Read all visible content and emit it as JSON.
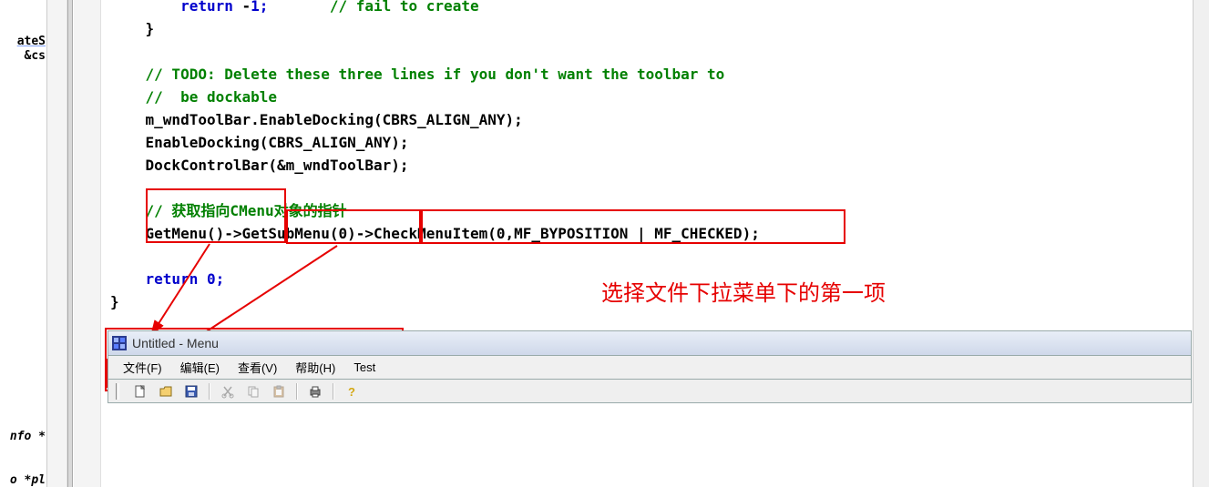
{
  "left_panel": {
    "label1": "ateS",
    "label2": " &cs",
    "label3": "nfo *",
    "label4": "o *pl"
  },
  "code": {
    "l1a": "        ",
    "l1b": "return",
    "l1c": " -",
    "l1d": "1;       ",
    "l1e": "// fail to create",
    "l2": "    }",
    "l3": "",
    "l4a": "    ",
    "l4b": "// TODO: Delete these three lines if you don't want the toolbar to",
    "l5a": "    ",
    "l5b": "//  be dockable",
    "l6": "    m_wndToolBar.EnableDocking(CBRS_ALIGN_ANY);",
    "l7": "    EnableDocking(CBRS_ALIGN_ANY);",
    "l8": "    DockControlBar(&m_wndToolBar);",
    "l9": "",
    "l10a": "    ",
    "l10b": "// 获取指向CMenu对象的指针",
    "l11": "    GetMenu()->GetSubMenu(0)->CheckMenuItem(0,MF_BYPOSITION | MF_CHECKED);",
    "l12": "",
    "l13a": "    ",
    "l13b": "return",
    "l13c": " 0;",
    "l14": "}"
  },
  "annotation": "选择文件下拉菜单下的第一项",
  "window": {
    "title": "Untitled - Menu",
    "menus": [
      "文件(F)",
      "编辑(E)",
      "查看(V)",
      "帮助(H)",
      "Test"
    ],
    "toolbar_icons": [
      "new",
      "open",
      "save",
      "cut",
      "copy",
      "paste",
      "print",
      "help"
    ]
  }
}
